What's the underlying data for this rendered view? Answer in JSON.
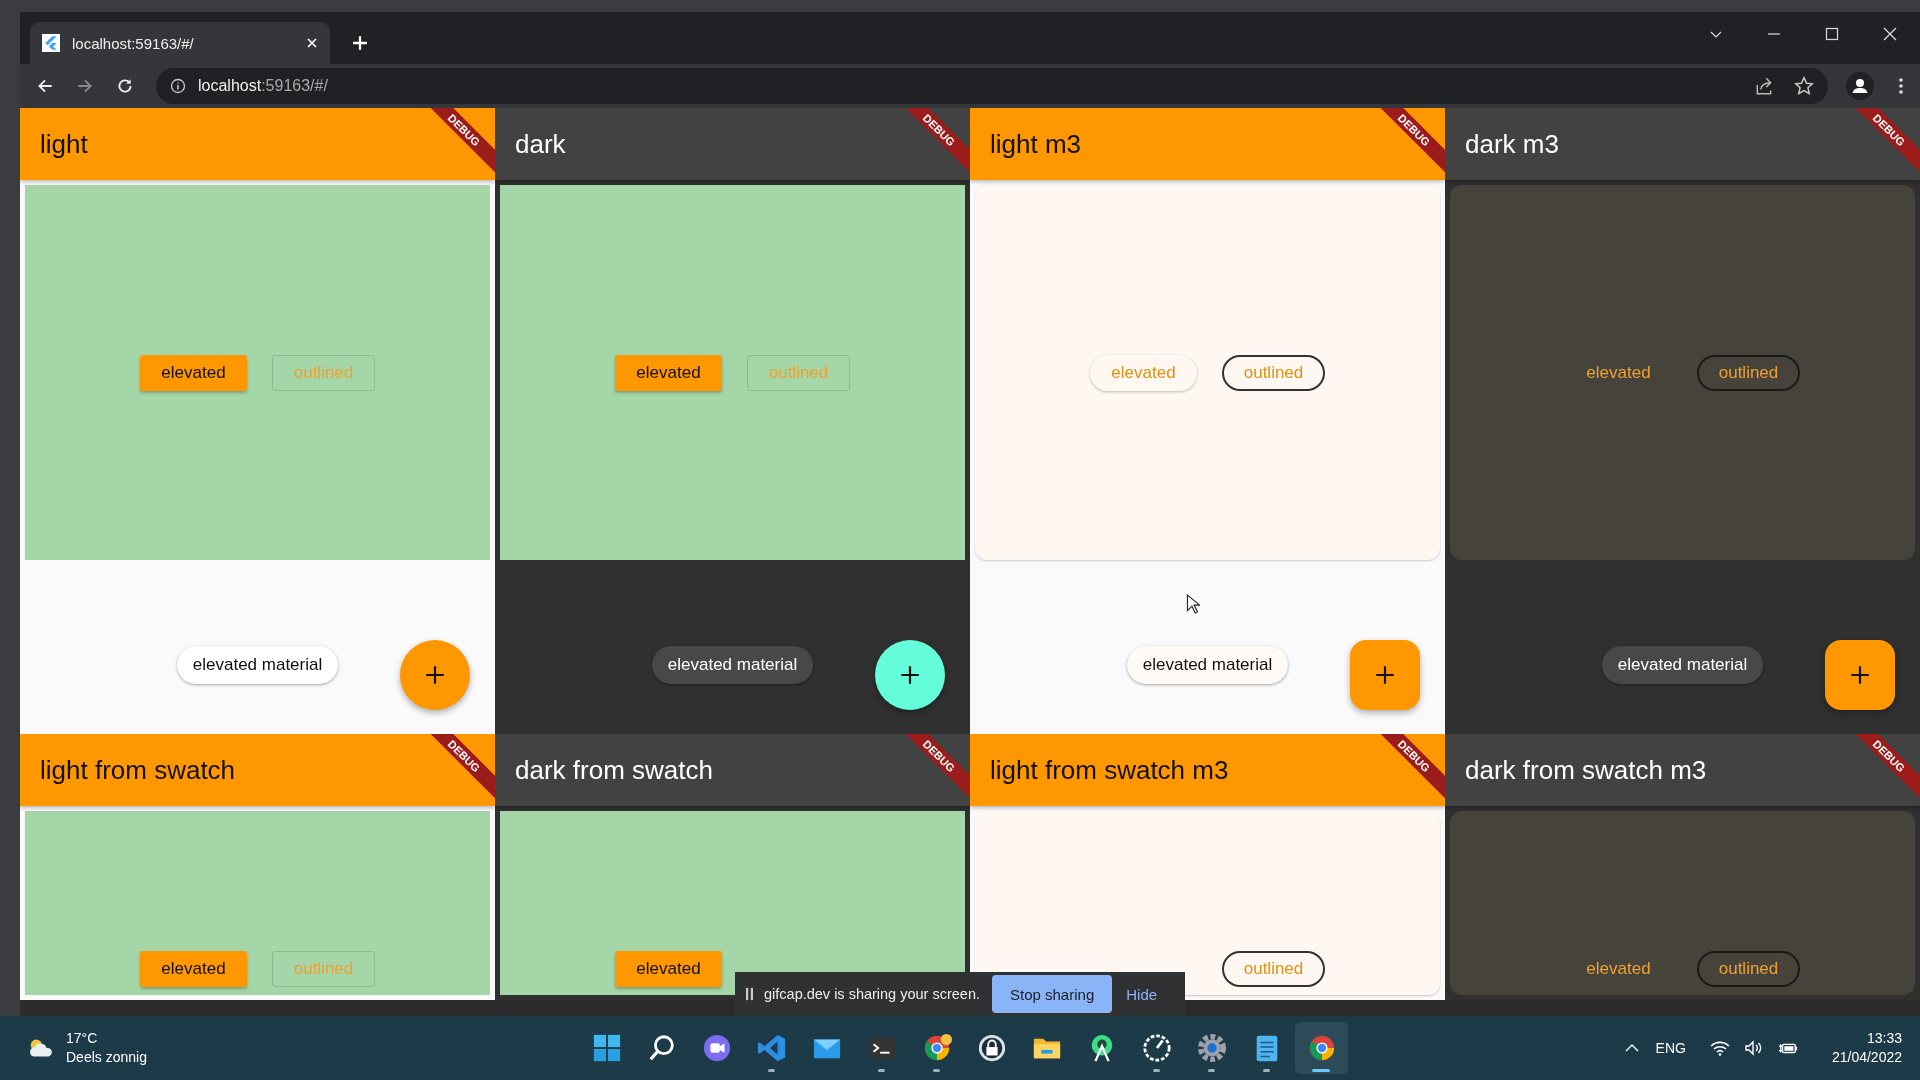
{
  "browser": {
    "tab": {
      "title": "localhost:59163/#/",
      "selected": true
    },
    "url": {
      "host": "localhost",
      "path": ":59163/#/"
    }
  },
  "panels": [
    {
      "title": "light",
      "kind": "light",
      "banner": "DEBUG",
      "buttons": [
        {
          "label": "elevated",
          "kind": "elevated"
        },
        {
          "label": "outlined",
          "kind": "outlined"
        }
      ],
      "chip": "elevated material"
    },
    {
      "title": "dark",
      "kind": "dark",
      "banner": "DEBUG",
      "buttons": [
        {
          "label": "elevated",
          "kind": "elevated"
        },
        {
          "label": "outlined",
          "kind": "outlined"
        }
      ],
      "chip": "elevated material"
    },
    {
      "title": "light m3",
      "kind": "light-m3",
      "banner": "DEBUG",
      "buttons": [
        {
          "label": "elevated",
          "kind": "elevated"
        },
        {
          "label": "outlined",
          "kind": "outlined"
        }
      ],
      "chip": "elevated material"
    },
    {
      "title": "dark m3",
      "kind": "dark-m3",
      "banner": "DEBUG",
      "buttons": [
        {
          "label": "elevated",
          "kind": "elevated"
        },
        {
          "label": "outlined",
          "kind": "outlined"
        }
      ],
      "chip": "elevated material"
    },
    {
      "title": "light from swatch",
      "kind": "light",
      "banner": "DEBUG",
      "buttons": [
        {
          "label": "elevated",
          "kind": "elevated"
        },
        {
          "label": "outlined",
          "kind": "outlined"
        }
      ]
    },
    {
      "title": "dark from swatch",
      "kind": "dark",
      "banner": "DEBUG",
      "buttons": [
        {
          "label": "elevated",
          "kind": "elevated"
        }
      ]
    },
    {
      "title": "light from swatch m3",
      "kind": "light-m3",
      "banner": "DEBUG",
      "buttons": [
        {
          "label": "outlined",
          "kind": "outlined"
        }
      ]
    },
    {
      "title": "dark from swatch m3",
      "kind": "dark-m3",
      "banner": "DEBUG",
      "buttons": [
        {
          "label": "elevated",
          "kind": "elevated"
        },
        {
          "label": "outlined",
          "kind": "outlined"
        }
      ]
    }
  ],
  "sharing_bar": {
    "message": "gifcap.dev is sharing your screen.",
    "stop": "Stop sharing",
    "hide": "Hide"
  },
  "taskbar": {
    "weather": {
      "temperature": "17°C",
      "condition": "Deels zonnig"
    },
    "apps": [
      {
        "kind": "start",
        "running": false,
        "selected": false
      },
      {
        "kind": "search",
        "running": false,
        "selected": false
      },
      {
        "kind": "chat",
        "running": false,
        "selected": false
      },
      {
        "kind": "code",
        "running": true,
        "selected": false
      },
      {
        "kind": "mail",
        "running": false,
        "selected": false
      },
      {
        "kind": "terminal",
        "running": true,
        "selected": false
      },
      {
        "kind": "browser-dev",
        "running": true,
        "selected": false
      },
      {
        "kind": "lock",
        "running": false,
        "selected": false
      },
      {
        "kind": "folder",
        "running": false,
        "selected": false
      },
      {
        "kind": "android",
        "running": false,
        "selected": false
      },
      {
        "kind": "gauge",
        "running": true,
        "selected": false
      },
      {
        "kind": "settings",
        "running": true,
        "selected": false
      },
      {
        "kind": "notepad",
        "running": true,
        "selected": false
      },
      {
        "kind": "browser",
        "running": true,
        "selected": true
      }
    ],
    "language": "ENG",
    "time": "13:33",
    "date": "21/04/2022"
  }
}
